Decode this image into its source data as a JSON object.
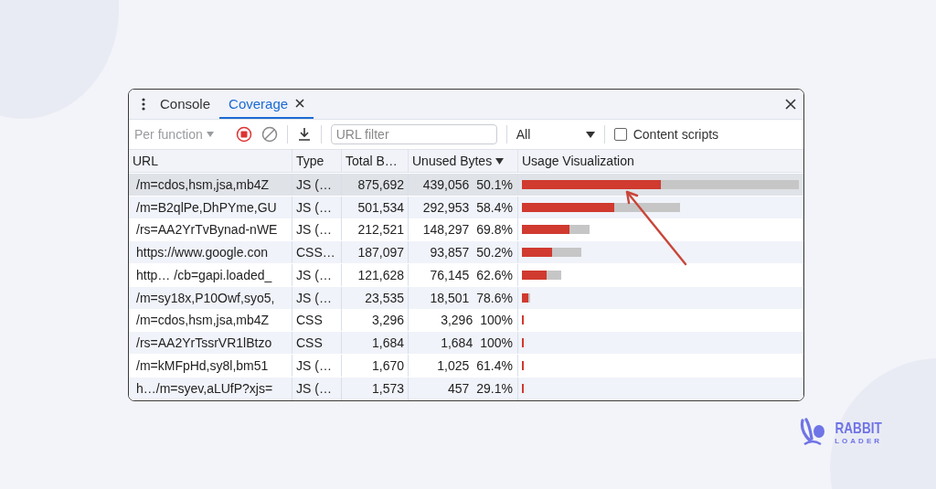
{
  "tabs": [
    {
      "label": "Console",
      "selected": false,
      "closable": false
    },
    {
      "label": "Coverage",
      "selected": true,
      "closable": true
    }
  ],
  "toolbar": {
    "mode": "Per function",
    "url_filter": {
      "placeholder": "URL filter"
    },
    "type_filter": "All",
    "content_scripts": {
      "label": "Content scripts",
      "checked": false
    }
  },
  "table": {
    "columns": [
      {
        "label": "URL",
        "sorted": false
      },
      {
        "label": "Type",
        "sorted": false
      },
      {
        "label": "Total B…",
        "sorted": false
      },
      {
        "label": "Unused Bytes",
        "sorted": true
      },
      {
        "label": "Usage Visualization",
        "sorted": false
      }
    ],
    "rows": [
      {
        "url": "/m=cdos,hsm,jsa,mb4Z",
        "type": "JS (…",
        "total": "875,692",
        "unused": "439,056",
        "percent": "50.1%",
        "selected": true,
        "bar": {
          "level": 1
        },
        "used": {
          "level": 0.5
        }
      },
      {
        "url": "/m=B2qlPe,DhPYme,GU",
        "type": "JS (…",
        "total": "501,534",
        "unused": "292,953",
        "percent": "58.4%",
        "selected": false,
        "bar": {
          "level": 0.57
        },
        "used": {
          "level": 0.334
        }
      },
      {
        "url": "/rs=AA2YrTvBynad-nWE",
        "type": "JS (…",
        "total": "212,521",
        "unused": "148,297",
        "percent": "69.8%",
        "selected": false,
        "bar": {
          "level": 0.243
        },
        "used": {
          "level": 0.17
        }
      },
      {
        "url": "https://www.google.con",
        "type": "CSS…",
        "total": "187,097",
        "unused": "93,857",
        "percent": "50.2%",
        "selected": false,
        "bar": {
          "level": 0.213
        },
        "used": {
          "level": 0.108
        }
      },
      {
        "url": "http…  /cb=gapi.loaded_",
        "type": "JS (…",
        "total": "121,628",
        "unused": "76,145",
        "percent": "62.6%",
        "selected": false,
        "bar": {
          "level": 0.141
        },
        "used": {
          "level": 0.089
        }
      },
      {
        "url": "/m=sy18x,P10Owf,syo5,",
        "type": "JS (…",
        "total": "23,535",
        "unused": "18,501",
        "percent": "78.6%",
        "selected": false,
        "bar": {
          "level": 0.03
        },
        "used": {
          "level": 0.023
        }
      },
      {
        "url": "/m=cdos,hsm,jsa,mb4Z",
        "type": "CSS",
        "total": "3,296",
        "unused": "3,296",
        "percent": "100%",
        "selected": false,
        "bar": {
          "level": 0.007
        },
        "used": {
          "level": 0.007
        }
      },
      {
        "url": "/rs=AA2YrTssrVR1lBtzo",
        "type": "CSS",
        "total": "1,684",
        "unused": "1,684",
        "percent": "100%",
        "selected": false,
        "bar": {
          "level": 0.007
        },
        "used": {
          "level": 0.007
        }
      },
      {
        "url": "/m=kMFpHd,sy8l,bm51",
        "type": "JS (…",
        "total": "1,670",
        "unused": "1,025",
        "percent": "61.4%",
        "selected": false,
        "bar": {
          "level": 0.007
        },
        "used": {
          "level": 0.007
        }
      },
      {
        "url": "h…/m=syev,aLUfP?xjs=",
        "type": "JS (…",
        "total": "1,573",
        "unused": "457",
        "percent": "29.1%",
        "selected": false,
        "bar": {
          "level": 0.007
        },
        "used": {
          "level": 0.007
        }
      }
    ]
  },
  "logo": {
    "line1": "RABBIT",
    "line2": "LOADER"
  }
}
